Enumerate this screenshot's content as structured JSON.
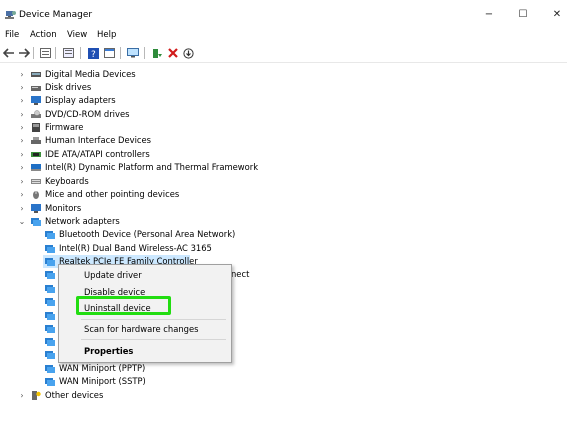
{
  "window": {
    "title": "Device Manager",
    "minimize": "−",
    "maximize": "☐",
    "close": "✕"
  },
  "menu": [
    "File",
    "Action",
    "View",
    "Help"
  ],
  "tree": {
    "categories_top": [
      {
        "label": "Digital Media Devices",
        "icon": "media-device-icon"
      },
      {
        "label": "Disk drives",
        "icon": "disk-drive-icon"
      },
      {
        "label": "Display adapters",
        "icon": "display-adapter-icon"
      },
      {
        "label": "DVD/CD-ROM drives",
        "icon": "dvd-drive-icon"
      },
      {
        "label": "Firmware",
        "icon": "firmware-icon"
      },
      {
        "label": "Human Interface Devices",
        "icon": "hid-icon"
      },
      {
        "label": "IDE ATA/ATAPI controllers",
        "icon": "ide-controller-icon"
      },
      {
        "label": "Intel(R) Dynamic Platform and Thermal Framework",
        "icon": "intel-platform-icon"
      },
      {
        "label": "Keyboards",
        "icon": "keyboard-icon"
      },
      {
        "label": "Mice and other pointing devices",
        "icon": "mouse-icon"
      },
      {
        "label": "Monitors",
        "icon": "monitor-icon"
      }
    ],
    "network_adapters": {
      "label": "Network adapters",
      "children": [
        "Bluetooth Device (Personal Area Network)",
        "Intel(R) Dual Band Wireless-AC 3165",
        "Realtek PCIe FE Family Controller"
      ],
      "partial_text": "nect",
      "children_bottom": [
        "WAN Miniport (PPTP)",
        "WAN Miniport (SSTP)"
      ]
    },
    "other_devices": "Other devices"
  },
  "context_menu": {
    "items": [
      "Update driver",
      "Disable device",
      "Uninstall device",
      "Scan for hardware changes",
      "Properties"
    ]
  },
  "colors": {
    "highlight": "#22dd11",
    "selection": "#cce8ff"
  }
}
